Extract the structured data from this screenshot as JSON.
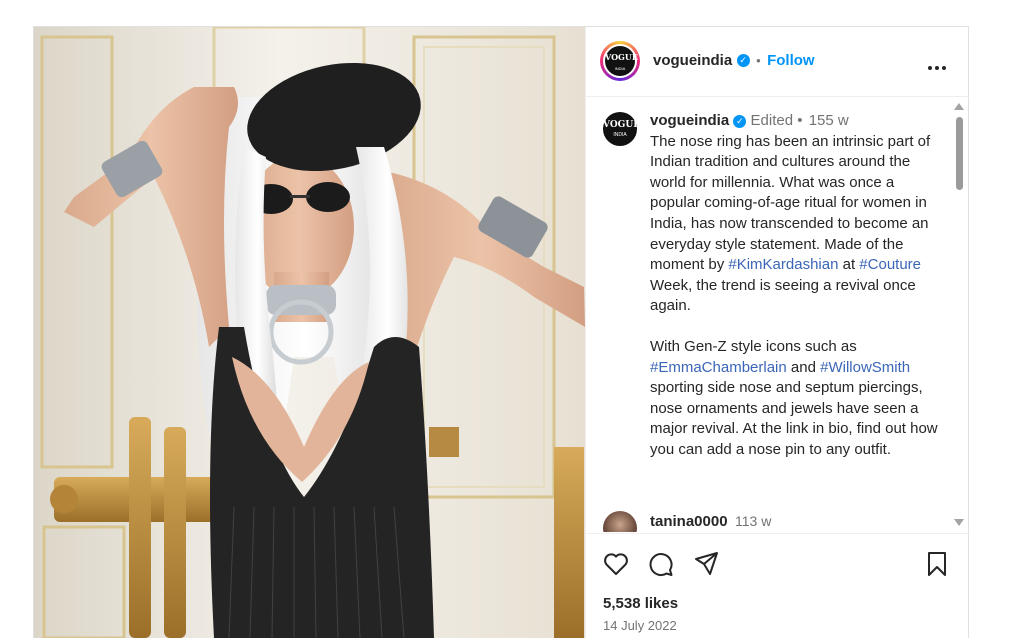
{
  "post": {
    "account": {
      "handle": "vogueindia",
      "separator": "•",
      "follow_label": "Follow",
      "more_icon": "more-horizontal-icon",
      "logo_text": "VOGUE",
      "logo_subtext": "INDIA"
    },
    "caption": {
      "handle": "vogueindia",
      "edited_label": "Edited",
      "separator": "•",
      "age": "155 w",
      "p1_a": "The nose ring has been an intrinsic part of Indian tradition and cultures around the world for millennia. What was once a popular coming-of-age ritual for women in India, has now transcended to become an everyday style statement. Made of the moment by ",
      "tag1": "#KimKardashian",
      "p1_b": " at ",
      "tag2": "#Couture",
      "p1_c": " Week, the trend is seeing a revival once again.",
      "p2_a": "With Gen-Z style icons such as ",
      "tag3": "#EmmaChamberlain",
      "p2_b": " and ",
      "tag4": "#WillowSmith",
      "p2_c": " sporting side nose and septum piercings, nose ornaments and jewels have seen a major revival. At the link in bio, find out how you can add a nose pin to any outfit."
    },
    "comment": {
      "username": "tanina0000",
      "age": "113 w"
    },
    "actions": {
      "like_icon": "heart-icon",
      "comment_icon": "comment-icon",
      "share_icon": "send-icon",
      "save_icon": "bookmark-icon",
      "likes": "5,538 likes",
      "date": "14 July 2022"
    },
    "colors": {
      "link_blue": "#0095f6",
      "hashtag": "#3b66b7",
      "text": "#262626",
      "muted": "#737373"
    }
  }
}
